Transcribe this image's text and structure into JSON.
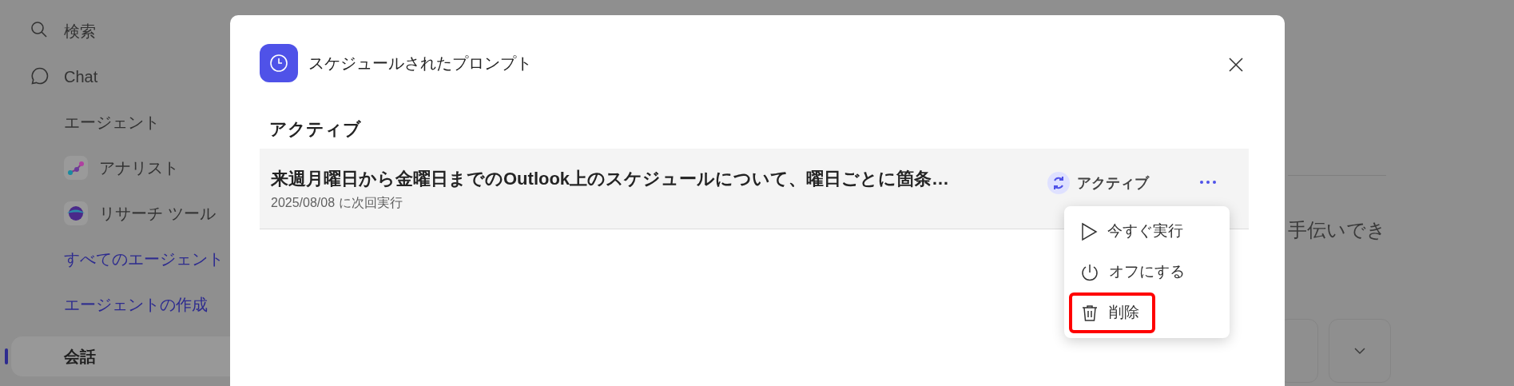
{
  "sidebar": {
    "items": [
      {
        "kind": "nav",
        "label": "検索",
        "selected": false
      },
      {
        "kind": "nav",
        "label": "Chat",
        "selected": false
      },
      {
        "kind": "heading",
        "label": "エージェント",
        "selected": false
      },
      {
        "kind": "agent",
        "label": "アナリスト",
        "selected": false
      },
      {
        "kind": "agent",
        "label": "リサーチ ツール",
        "selected": false
      },
      {
        "kind": "link",
        "label": "すべてのエージェント",
        "selected": false
      },
      {
        "kind": "link",
        "label": "エージェントの作成",
        "selected": false
      },
      {
        "kind": "nav",
        "label": "会話",
        "selected": true
      }
    ]
  },
  "background": {
    "partial_text": "手伝いでき"
  },
  "dialog": {
    "title": "スケジュールされたプロンプト",
    "section": "アクティブ",
    "prompts": [
      {
        "title": "来週月曜日から金曜日までのOutlook上のスケジュールについて、曜日ごとに箇条…",
        "next_run": "2025/08/08 に次回実行",
        "status": "アクティブ",
        "active": true
      }
    ],
    "menu": [
      {
        "label": "今すぐ実行",
        "highlighted": false
      },
      {
        "label": "オフにする",
        "highlighted": false
      },
      {
        "label": "削除",
        "highlighted": true
      }
    ]
  }
}
